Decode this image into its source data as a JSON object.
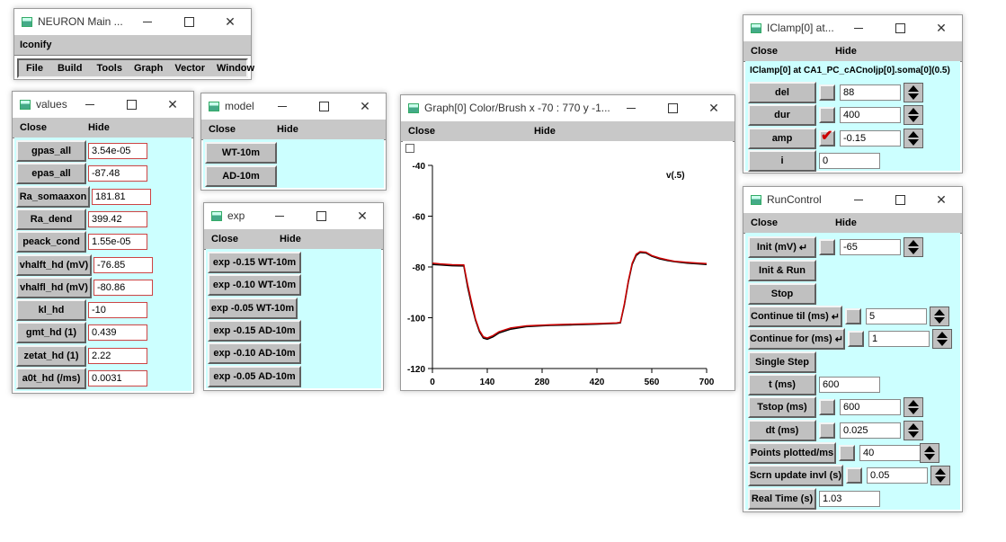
{
  "main": {
    "title": "NEURON Main ...",
    "iconify": "Iconify",
    "menu": [
      "File",
      "Build",
      "Tools",
      "Graph",
      "Vector",
      "Window"
    ]
  },
  "common": {
    "close": "Close",
    "hide": "Hide"
  },
  "values": {
    "title": "values",
    "rows": [
      {
        "label": "gpas_all",
        "value": "3.54e-05"
      },
      {
        "label": "epas_all",
        "value": "-87.48"
      },
      {
        "label": "Ra_somaaxon",
        "value": "181.81"
      },
      {
        "label": "Ra_dend",
        "value": "399.42"
      },
      {
        "label": "peack_cond",
        "value": "1.55e-05"
      },
      {
        "label": "vhalft_hd (mV)",
        "value": "-76.85"
      },
      {
        "label": "vhalfl_hd (mV)",
        "value": "-80.86"
      },
      {
        "label": "kl_hd",
        "value": "-10"
      },
      {
        "label": "gmt_hd (1)",
        "value": "0.439"
      },
      {
        "label": "zetat_hd (1)",
        "value": "2.22"
      },
      {
        "label": "a0t_hd (/ms)",
        "value": "0.0031"
      }
    ]
  },
  "model": {
    "title": "model",
    "buttons": [
      "WT-10m",
      "AD-10m"
    ]
  },
  "exp": {
    "title": "exp",
    "buttons": [
      "exp -0.15 WT-10m",
      "exp -0.10 WT-10m",
      "exp -0.05 WT-10m",
      "exp -0.15 AD-10m",
      "exp -0.10 AD-10m",
      "exp -0.05 AD-10m"
    ]
  },
  "graph": {
    "title": "Graph[0] Color/Brush x -70 : 770  y -1...",
    "legend": "v(.5)"
  },
  "chart_data": {
    "type": "line",
    "xlim": [
      0,
      700
    ],
    "ylim": [
      -120,
      -40
    ],
    "xticks": [
      "0",
      "140",
      "280",
      "420",
      "560",
      "700"
    ],
    "yticks": [
      "-40",
      "-60",
      "-80",
      "-100",
      "-120"
    ],
    "series": [
      {
        "name": "v(.5)",
        "color": "#000000",
        "x": [
          0,
          20,
          50,
          80,
          90,
          100,
          110,
          120,
          130,
          140,
          155,
          170,
          200,
          240,
          300,
          360,
          420,
          470,
          480,
          490,
          500,
          510,
          520,
          530,
          545,
          560,
          580,
          600,
          620,
          650,
          680,
          700
        ],
        "y": [
          -79,
          -79.2,
          -79.5,
          -79.6,
          -88,
          -95,
          -101,
          -105.5,
          -108,
          -108.5,
          -107.5,
          -106,
          -104.5,
          -103.5,
          -103,
          -102.8,
          -102.5,
          -102.2,
          -102,
          -95,
          -86,
          -79,
          -75.5,
          -74.3,
          -74.5,
          -75.8,
          -76.8,
          -77.5,
          -78,
          -78.5,
          -78.8,
          -79
        ]
      },
      {
        "name": "v(.5)",
        "color": "#cc0000",
        "x": [
          0,
          20,
          50,
          80,
          90,
          100,
          110,
          120,
          130,
          140,
          155,
          170,
          200,
          240,
          300,
          360,
          420,
          470,
          480,
          490,
          500,
          510,
          520,
          530,
          545,
          560,
          580,
          600,
          620,
          650,
          680,
          700
        ],
        "y": [
          -78.5,
          -78.8,
          -79.1,
          -79.2,
          -87,
          -94,
          -100.5,
          -105,
          -107.5,
          -108,
          -107,
          -105.5,
          -104,
          -103.2,
          -102.8,
          -102.5,
          -102.3,
          -102,
          -101.8,
          -94.5,
          -85.5,
          -78.5,
          -75,
          -74,
          -74.2,
          -75.5,
          -76.5,
          -77.2,
          -77.8,
          -78.2,
          -78.5,
          -78.7
        ]
      }
    ]
  },
  "iclamp": {
    "title": "IClamp[0] at...",
    "header": "IClamp[0] at CA1_PC_cACnoljp[0].soma[0](0.5)",
    "rows": [
      {
        "label": "del",
        "value": "88"
      },
      {
        "label": "dur",
        "value": "400"
      },
      {
        "label": "amp",
        "value": "-0.15"
      },
      {
        "label": "i",
        "value": "0"
      }
    ]
  },
  "run": {
    "title": "RunControl",
    "init": {
      "label": "Init (mV)",
      "value": "-65"
    },
    "initrun": "Init & Run",
    "stop": "Stop",
    "continue_til": {
      "label": "Continue til (ms)",
      "value": "5"
    },
    "continue_for": {
      "label": "Continue for (ms)",
      "value": "1"
    },
    "single_step": "Single Step",
    "t": {
      "label": "t (ms)",
      "value": "600"
    },
    "tstop": {
      "label": "Tstop (ms)",
      "value": "600"
    },
    "dt": {
      "label": "dt (ms)",
      "value": "0.025"
    },
    "points": {
      "label": "Points plotted/ms",
      "value": "40"
    },
    "scrn": {
      "label": "Scrn update invl (s)",
      "value": "0.05"
    },
    "realtime": {
      "label": "Real Time (s)",
      "value": "1.03"
    }
  }
}
